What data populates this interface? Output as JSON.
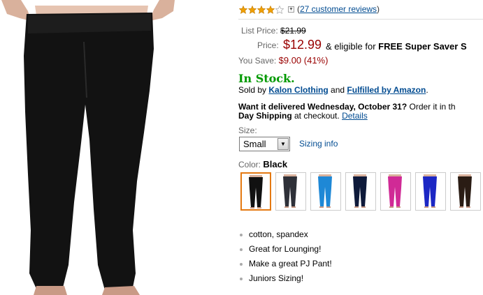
{
  "rating": {
    "stars": 4,
    "max": 5,
    "reviews_link": "27 customer reviews",
    "open_paren": "(",
    "close_paren": ")"
  },
  "pricing": {
    "list_label": "List Price:",
    "list_value": "$21.99",
    "price_label": "Price:",
    "price_value": "$12.99",
    "eligible_text": "& eligible for",
    "shipping_text": "FREE Super Saver S",
    "save_label": "You Save:",
    "save_value": "$9.00 (41%)"
  },
  "availability": {
    "status": "In Stock.",
    "sold_by_prefix": "Sold by",
    "seller": "Kalon Clothing",
    "and_text": "and",
    "fulfilled": "Fulfilled by Amazon",
    "period": "."
  },
  "delivery": {
    "headline": "Want it delivered Wednesday, October 31?",
    "order_text": " Order it in th",
    "line2_bold": "Day Shipping",
    "line2_text": " at checkout.",
    "details_link": "Details"
  },
  "size": {
    "label": "Size:",
    "selected": "Small",
    "sizing_info": "Sizing info"
  },
  "color": {
    "label": "Color:",
    "selected": "Black",
    "swatches": [
      {
        "name": "Black",
        "hex": "#111111"
      },
      {
        "name": "Charcoal",
        "hex": "#2e3038"
      },
      {
        "name": "Turquoise",
        "hex": "#1e88d6"
      },
      {
        "name": "Navy",
        "hex": "#0e1a3a"
      },
      {
        "name": "Pink",
        "hex": "#d02a96"
      },
      {
        "name": "Royal Blue",
        "hex": "#1c27c4"
      },
      {
        "name": "Brown",
        "hex": "#2a1c14"
      }
    ]
  },
  "features": [
    "cotton, spandex",
    "Great for Lounging!",
    "Make a great PJ Pant!",
    "Juniors Sizing!"
  ],
  "colors": {
    "price_red": "#990000",
    "link_blue": "#004b91",
    "stock_green": "#009900",
    "star_gold": "#f0a000",
    "selected_orange": "#e47911"
  }
}
